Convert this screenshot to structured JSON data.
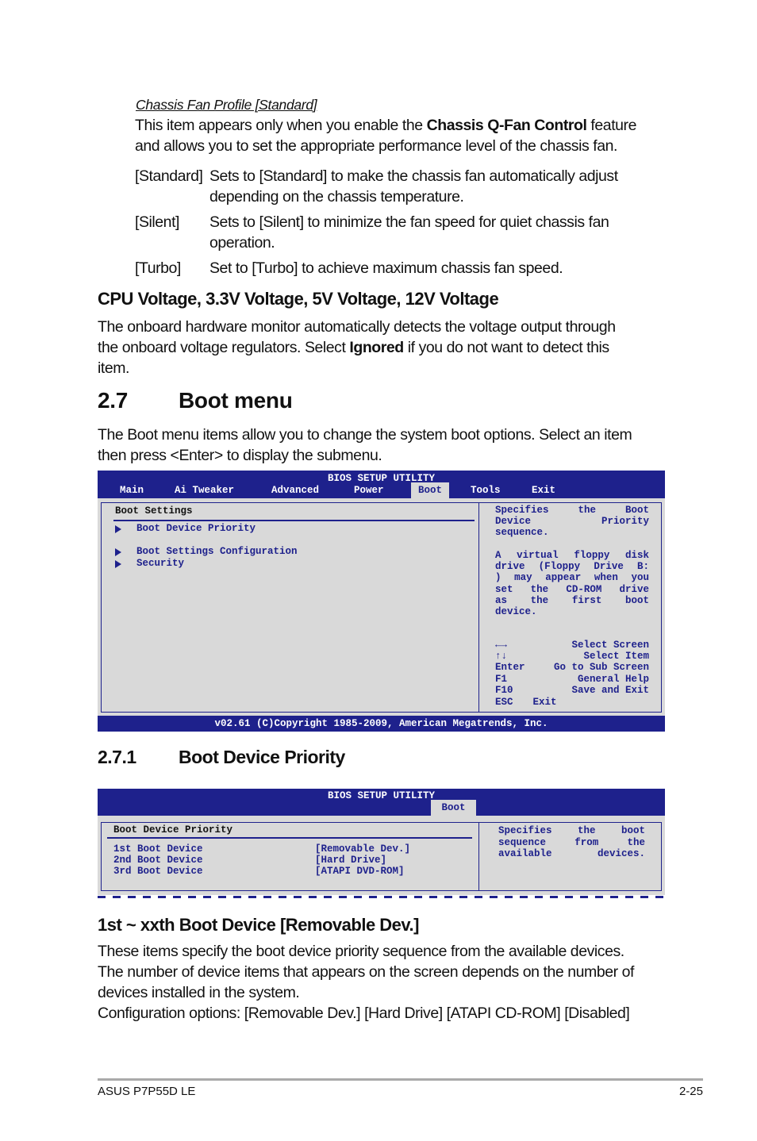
{
  "chassis": {
    "title": "Chassis Fan Profile [Standard]",
    "lines": [
      [
        {
          "t": "This item appears only when you enable the "
        },
        {
          "t": "Chassis Q-Fan Control",
          "b": true
        },
        {
          "t": " feature"
        }
      ],
      [
        {
          "t": "and allows you to set the appropriate performance level of the chassis fan."
        }
      ]
    ],
    "options": [
      {
        "label": "[Standard]",
        "lines": [
          "Sets to [Standard] to make the chassis fan automatically adjust",
          "depending on the chassis temperature."
        ]
      },
      {
        "label": "[Silent]",
        "lines": [
          "Sets to [Silent] to minimize the fan speed for quiet chassis fan",
          "operation."
        ]
      },
      {
        "label": "[Turbo]",
        "lines": [
          "Set to [Turbo] to achieve maximum chassis fan speed."
        ]
      }
    ]
  },
  "voltage": {
    "heading": "CPU Voltage, 3.3V Voltage, 5V Voltage, 12V Voltage",
    "lines": [
      [
        {
          "t": "The onboard hardware monitor automatically detects the voltage output through"
        }
      ],
      [
        {
          "t": "the onboard voltage regulators. Select "
        },
        {
          "t": "Ignored",
          "b": true
        },
        {
          "t": " if you do not want to detect this"
        }
      ],
      [
        {
          "t": "item."
        }
      ]
    ]
  },
  "boot_menu": {
    "number": "2.7",
    "title": "Boot menu",
    "lines": [
      [
        {
          "t": "The Boot menu items allow you to change the system boot options. Select an item"
        }
      ],
      [
        {
          "t": "then press <Enter> to display the submenu."
        }
      ]
    ]
  },
  "bios1": {
    "title": "BIOS SETUP UTILITY",
    "tabs": [
      {
        "label": "Main"
      },
      {
        "label": "Ai Tweaker"
      },
      {
        "label": "Advanced"
      },
      {
        "label": "Power"
      },
      {
        "label": "Boot",
        "selected": true
      },
      {
        "label": "Tools"
      },
      {
        "label": "Exit"
      }
    ],
    "section": "Boot Settings",
    "items": [
      "Boot Device Priority",
      "Boot Settings Configuration",
      "Security"
    ],
    "help": [
      "Specifies the Boot",
      "Device Priority",
      "sequence.",
      "",
      "A virtual floppy disk",
      "drive (Floppy Drive B:",
      ") may appear when you",
      "set the CD-ROM drive",
      "as the first boot",
      "device."
    ],
    "keys": [
      {
        "key": "←→",
        "desc": "Select Screen"
      },
      {
        "key": "↑↓",
        "desc": "Select Item"
      },
      {
        "key": "Enter",
        "desc": "Go to Sub Screen"
      },
      {
        "key": "F1",
        "desc": "General Help"
      },
      {
        "key": "F10",
        "desc": "Save and Exit"
      },
      {
        "key": "ESC",
        "desc": "Exit"
      }
    ],
    "footer": "v02.61 (C)Copyright 1985-2009, American Megatrends, Inc.",
    "colors": {
      "blue": "#1e218c",
      "gray": "#d9d9d9"
    }
  },
  "boot_priority": {
    "number": "2.7.1",
    "title": "Boot Device Priority"
  },
  "bios2": {
    "title": "BIOS SETUP UTILITY",
    "tab": "Boot",
    "section": "Boot Device Priority",
    "rows": [
      {
        "label": "1st Boot Device",
        "value": "[Removable Dev.]"
      },
      {
        "label": "2nd Boot Device",
        "value": "[Hard Drive]"
      },
      {
        "label": "3rd Boot Device",
        "value": "[ATAPI DVD-ROM]"
      }
    ],
    "help": [
      "Specifies the boot",
      "sequence from the",
      "available devices."
    ]
  },
  "boot_device": {
    "heading": "1st ~ xxth Boot Device [Removable Dev.]",
    "lines": [
      "These items specify the boot device priority sequence from the available devices.",
      "The number of device items that appears on the screen depends on the number of",
      "devices installed in the system.",
      "Configuration options: [Removable Dev.] [Hard Drive] [ATAPI CD-ROM] [Disabled]"
    ]
  },
  "footer": {
    "left": "ASUS P7P55D LE",
    "right": "2-25"
  }
}
